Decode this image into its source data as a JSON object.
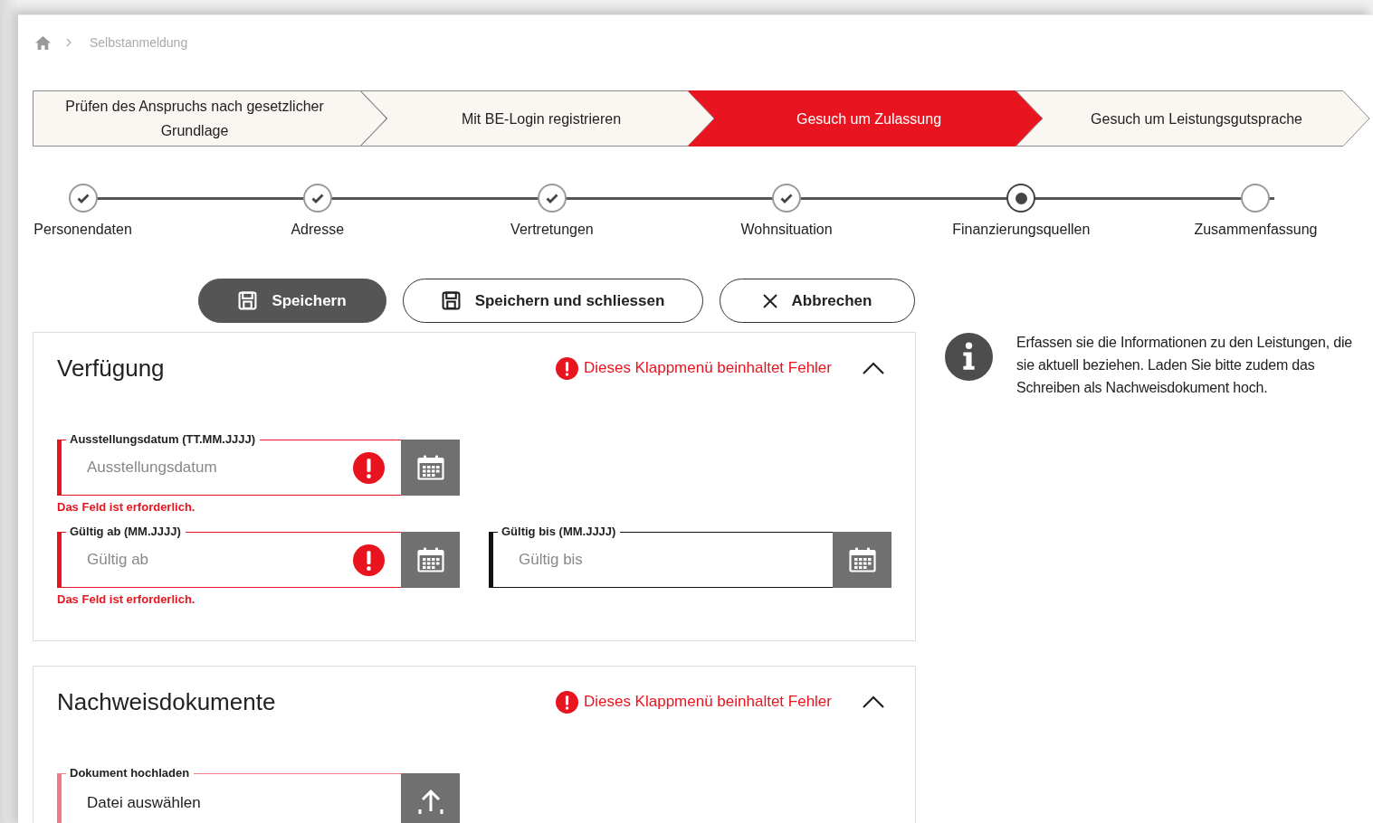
{
  "breadcrumb": [
    "Selbstanmeldung"
  ],
  "process_steps": [
    {
      "label": "Prüfen des Anspruchs nach gesetzlicher Grundlage",
      "selected": false
    },
    {
      "label": "Mit BE-Login registrieren",
      "selected": false
    },
    {
      "label": "Gesuch um Zulassung",
      "selected": true
    },
    {
      "label": "Gesuch um Leistungsgutsprache",
      "selected": false
    }
  ],
  "wizard_steps": [
    {
      "label": "Personendaten",
      "completed": true,
      "selected": false
    },
    {
      "label": "Adresse",
      "completed": true,
      "selected": false
    },
    {
      "label": "Vertretungen",
      "completed": true,
      "selected": false
    },
    {
      "label": "Wohnsituation",
      "completed": true,
      "selected": false
    },
    {
      "label": "Finanzierungsquellen",
      "completed": false,
      "selected": true
    },
    {
      "label": "Zusammenfassung",
      "completed": false,
      "selected": false
    }
  ],
  "buttons": [
    {
      "label": "Speichern",
      "kind": "save",
      "primary": true
    },
    {
      "label": "Speichern und schliessen",
      "kind": "save",
      "primary": false
    },
    {
      "label": "Abbrechen",
      "kind": "cancel",
      "primary": false
    }
  ],
  "panels": [
    {
      "title": "Verfügung",
      "error": "Dieses Klappmenü beinhaltet Fehler",
      "expanded": true,
      "rows": [
        [
          {
            "kind": "date",
            "label": "Ausstellungsdatum (TT.MM.JJJJ)",
            "placeholder": "Ausstellungsdatum",
            "invalid": true,
            "message": "Das Feld ist erforderlich."
          }
        ],
        [
          {
            "kind": "date",
            "label": "Gültig ab (MM.JJJJ)",
            "placeholder": "Gültig ab",
            "invalid": true,
            "message": "Das Feld ist erforderlich."
          },
          {
            "kind": "date",
            "label": "Gültig bis (MM.JJJJ)",
            "placeholder": "Gültig bis",
            "invalid": false
          }
        ]
      ]
    },
    {
      "title": "Nachweisdokumente",
      "error": "Dieses Klappmenü beinhaltet Fehler",
      "expanded": true,
      "rows": [
        [
          {
            "kind": "upload",
            "label": "Dokument hochladen",
            "value": "Datei auswählen",
            "invalid": true
          }
        ]
      ]
    }
  ],
  "info": {
    "text": "Erfassen sie die Informationen zu den Leistungen, die sie aktuell beziehen. Laden Sie bitte zudem das Schreiben als Nachweisdokument hoch."
  }
}
